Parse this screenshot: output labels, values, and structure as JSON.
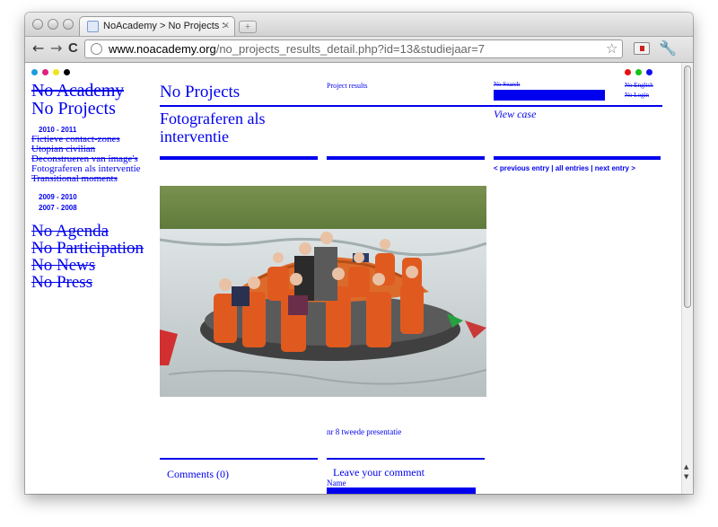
{
  "browser": {
    "tab_title": "NoAcademy > No Projects >",
    "tab_close": "✕",
    "new_tab": "+",
    "url_domain": "www.noacademy.org",
    "url_path": "/no_projects_results_detail.php?id=13&studiejaar=7",
    "back": "←",
    "forward": "→",
    "reload": "C",
    "star": "☆",
    "wrench": "🔧"
  },
  "colors": {
    "link": "#0000ee",
    "left_dots": [
      "#1e9be0",
      "#e0207a",
      "#f4e21a",
      "#000000"
    ],
    "right_dots": [
      "#e81010",
      "#16c216",
      "#1010ee"
    ]
  },
  "sidebar": {
    "logo": "No Academy",
    "title": "No Projects",
    "years_top": [
      "2010 - 2011"
    ],
    "projects": [
      {
        "label": "Fictieve contact-zones",
        "struck": true
      },
      {
        "label": "Utopian civilian",
        "struck": true
      },
      {
        "label": "Deconstrueren van image's",
        "struck": true
      },
      {
        "label": "Fotograferen als interventie",
        "struck": false
      },
      {
        "label": "Transitional moments",
        "struck": true
      }
    ],
    "years_bottom": [
      "2009 - 2010",
      "2007 - 2008"
    ],
    "nav": [
      "No Agenda",
      "No Participation",
      "No News",
      "No Press"
    ]
  },
  "main": {
    "heading": "No Projects",
    "breadcrumb": "Project results",
    "entry_title": "Fotograferen als interventie",
    "view_case": "View case",
    "entry_nav": {
      "prev": "< previous entry",
      "sep1": " | ",
      "all": "all entries",
      "sep2": " | ",
      "next": "next entry >"
    },
    "caption": "nr 8 tweede presentatie",
    "comments": "Comments (0)",
    "leave_comment": "Leave your comment",
    "name_label": "Name"
  },
  "topright": {
    "search": "No Search",
    "english": "No English",
    "login": "No Login"
  }
}
